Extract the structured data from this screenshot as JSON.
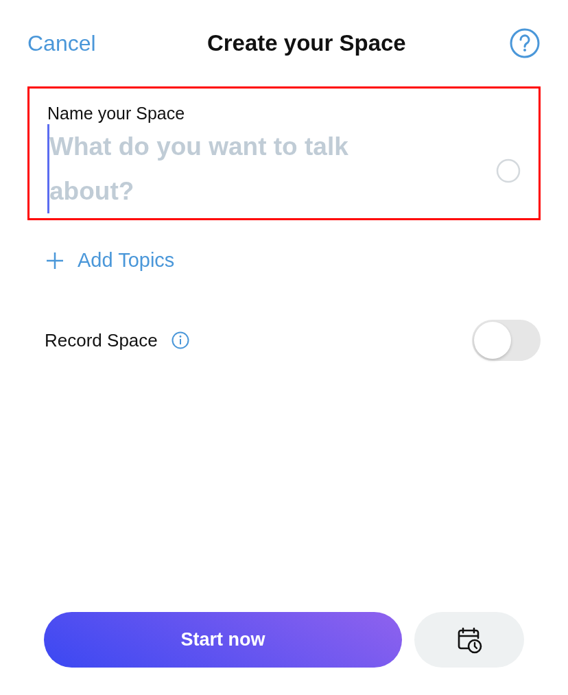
{
  "header": {
    "cancel": "Cancel",
    "title": "Create your Space"
  },
  "name_field": {
    "label": "Name your Space",
    "placeholder": "What do you want to talk about?",
    "highlighted": true
  },
  "add_topics": {
    "label": "Add Topics"
  },
  "record": {
    "label": "Record Space",
    "on": false
  },
  "actions": {
    "start": "Start now"
  }
}
